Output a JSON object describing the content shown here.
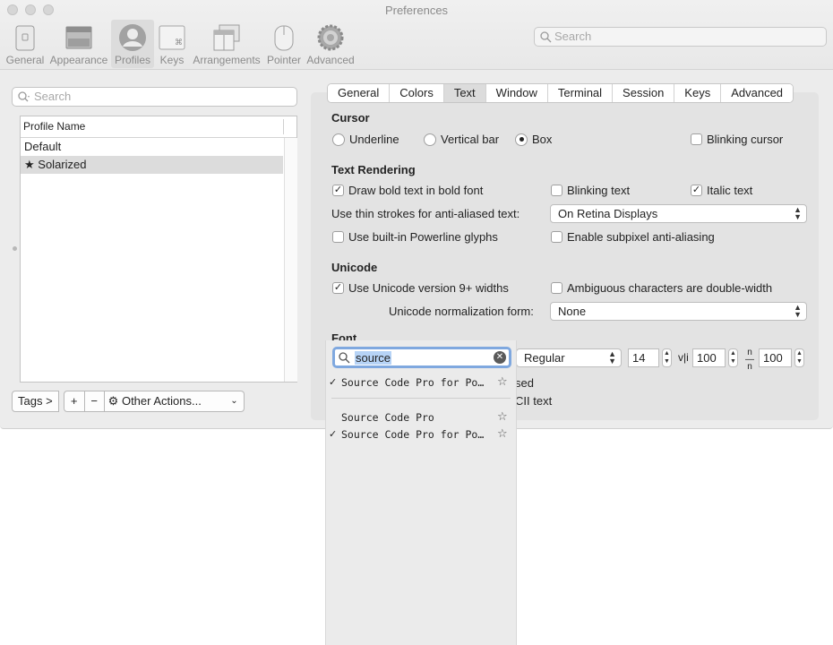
{
  "window": {
    "title": "Preferences"
  },
  "toolbar": {
    "items": [
      {
        "label": "General",
        "icon": "phone-icon"
      },
      {
        "label": "Appearance",
        "icon": "window-icon"
      },
      {
        "label": "Profiles",
        "icon": "profile-icon"
      },
      {
        "label": "Keys",
        "icon": "keyboard-icon"
      },
      {
        "label": "Arrangements",
        "icon": "arrangements-icon"
      },
      {
        "label": "Pointer",
        "icon": "mouse-icon"
      },
      {
        "label": "Advanced",
        "icon": "gear-icon"
      }
    ],
    "active": "Profiles",
    "search_placeholder": "Search"
  },
  "sidebar": {
    "search_placeholder": "Search",
    "column_header": "Profile Name",
    "profiles": [
      {
        "name": "Default",
        "star": ""
      },
      {
        "name": "Solarized",
        "star": "★"
      }
    ],
    "selected": "Solarized",
    "buttons": {
      "tags": "Tags >",
      "add": "+",
      "remove": "−",
      "other_actions": "Other Actions..."
    }
  },
  "tabs": {
    "items": [
      "General",
      "Colors",
      "Text",
      "Window",
      "Terminal",
      "Session",
      "Keys",
      "Advanced"
    ],
    "active": "Text"
  },
  "cursor": {
    "title": "Cursor",
    "options": {
      "underline": "Underline",
      "vertical_bar": "Vertical bar",
      "box": "Box"
    },
    "selected": "Box",
    "blinking_label": "Blinking cursor",
    "blinking_checked": false
  },
  "text_rendering": {
    "title": "Text Rendering",
    "bold_label": "Draw bold text in bold font",
    "bold_checked": true,
    "blinking_text_label": "Blinking text",
    "blinking_text_checked": false,
    "italic_label": "Italic text",
    "italic_checked": true,
    "thin_strokes_label": "Use thin strokes for anti-aliased text:",
    "thin_strokes_value": "On Retina Displays",
    "powerline_label": "Use built-in Powerline glyphs",
    "powerline_checked": false,
    "subpixel_label": "Enable subpixel anti-aliasing",
    "subpixel_checked": false
  },
  "unicode": {
    "title": "Unicode",
    "version_label": "Use Unicode version 9+ widths",
    "version_checked": true,
    "ambiguous_label": "Ambiguous characters are double-width",
    "ambiguous_checked": false,
    "normalization_label": "Unicode normalization form:",
    "normalization_value": "None"
  },
  "font": {
    "title": "Font",
    "weight": "Regular",
    "size": "14",
    "horizontal_spacing": "100",
    "vertical_spacing": "100",
    "obscured_text_1": "sed",
    "obscured_text_2": "CII text"
  },
  "font_popup": {
    "search_value": "source",
    "recent": [
      {
        "name": "Source Code Pro for Po…",
        "checked": true
      }
    ],
    "results": [
      {
        "name": "Source Code Pro",
        "checked": false
      },
      {
        "name": "Source Code Pro for Po…",
        "checked": true
      }
    ]
  },
  "colors": {
    "selection": "#b6d3f6",
    "focus_ring": "#7fa8df",
    "panel": "#e3e3e3"
  }
}
